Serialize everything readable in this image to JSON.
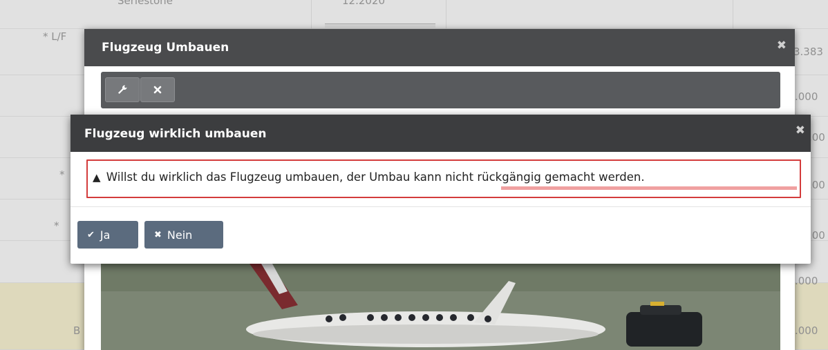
{
  "background": {
    "rows": [
      {
        "label": "Seriestone",
        "value": "12.2020"
      },
      {
        "label": "* L/F",
        "right": "3.383"
      },
      {
        "label": "",
        "right": ".000"
      },
      {
        "label": "",
        "right": ".00"
      },
      {
        "label": "*",
        "right": ".00"
      },
      {
        "label": "*",
        "right": ".00"
      },
      {
        "label": "",
        "right": ".000"
      },
      {
        "label": "B",
        "right": ".000"
      }
    ]
  },
  "outer_dialog": {
    "title": "Flugzeug Umbauen",
    "close": "✖",
    "toolbar": {
      "rebuild_icon": "wrench-icon",
      "cancel_icon": "close-icon"
    }
  },
  "inner_dialog": {
    "title": "Flugzeug wirklich umbauen",
    "close": "✖",
    "message": "Willst du wirklich das Flugzeug umbauen, der Umbau kann nicht rückgängig gemacht werden.",
    "warning_icon": "warning-icon",
    "buttons": {
      "yes": "Ja",
      "no": "Nein"
    }
  }
}
